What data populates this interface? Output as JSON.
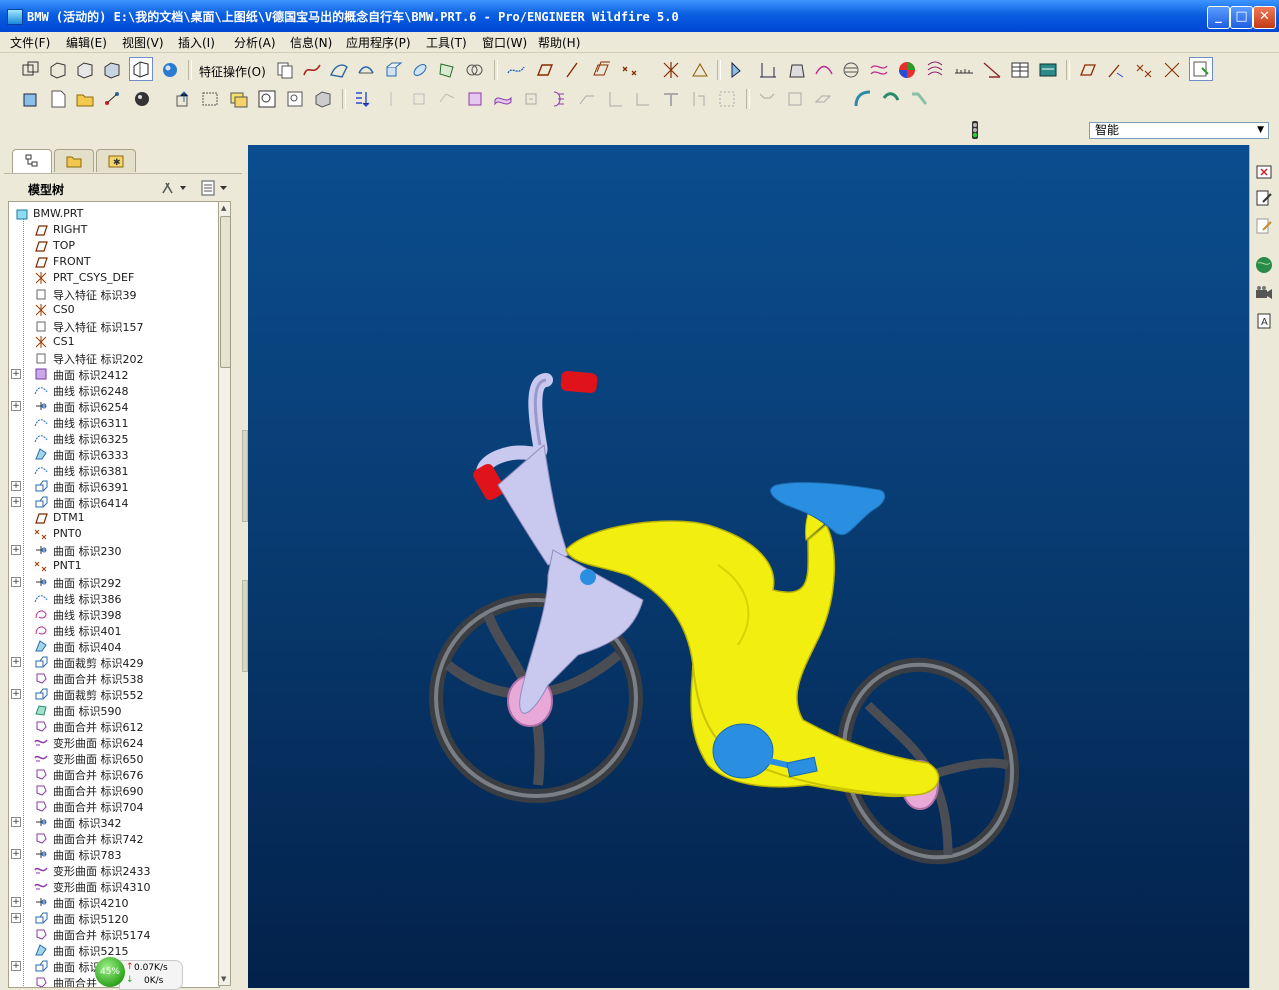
{
  "window": {
    "title": "BMW (活动的) E:\\我的文档\\桌面\\上图纸\\V德国宝马出的概念自行车\\BMW.PRT.6 - Pro/ENGINEER Wildfire 5.0",
    "minimize": "_",
    "maximize": "□",
    "close": "✕"
  },
  "menu": [
    "文件(F)",
    "编辑(E)",
    "视图(V)",
    "插入(I)",
    "分析(A)",
    "信息(N)",
    "应用程序(P)",
    "工具(T)",
    "窗口(W)",
    "帮助(H)"
  ],
  "toolbar": {
    "feature_ops_label": "特征操作(O)"
  },
  "filter": {
    "selected": "智能"
  },
  "model_tree": {
    "title": "模型树",
    "root": "BMW.PRT",
    "items": [
      {
        "label": "RIGHT",
        "icon": "datum-plane-icon",
        "expand": false
      },
      {
        "label": "TOP",
        "icon": "datum-plane-icon",
        "expand": false
      },
      {
        "label": "FRONT",
        "icon": "datum-plane-icon",
        "expand": false
      },
      {
        "label": "PRT_CSYS_DEF",
        "icon": "csys-icon",
        "expand": false
      },
      {
        "label": "导入特征 标识39",
        "icon": "import-feature-icon",
        "expand": false
      },
      {
        "label": "CS0",
        "icon": "csys-icon",
        "expand": false
      },
      {
        "label": "导入特征 标识157",
        "icon": "import-feature-icon",
        "expand": false
      },
      {
        "label": "CS1",
        "icon": "csys-icon",
        "expand": false
      },
      {
        "label": "导入特征 标识202",
        "icon": "import-feature-icon",
        "expand": false
      },
      {
        "label": "曲面 标识2412",
        "icon": "surface-icon",
        "expand": true
      },
      {
        "label": "曲线 标识6248",
        "icon": "curve-icon",
        "expand": false
      },
      {
        "label": "曲面 标识6254",
        "icon": "extrude-surface-icon",
        "expand": true
      },
      {
        "label": "曲线 标识6311",
        "icon": "curve-icon",
        "expand": false
      },
      {
        "label": "曲线 标识6325",
        "icon": "curve-icon",
        "expand": false
      },
      {
        "label": "曲面 标识6333",
        "icon": "boundary-surface-icon",
        "expand": false
      },
      {
        "label": "曲线 标识6381",
        "icon": "curve-icon",
        "expand": false
      },
      {
        "label": "曲面 标识6391",
        "icon": "sweep-surface-icon",
        "expand": true
      },
      {
        "label": "曲面 标识6414",
        "icon": "sweep-surface-icon",
        "expand": true
      },
      {
        "label": "DTM1",
        "icon": "datum-plane-icon",
        "expand": false
      },
      {
        "label": "PNT0",
        "icon": "datum-point-icon",
        "expand": false
      },
      {
        "label": "曲面 标识230",
        "icon": "extrude-surface-icon",
        "expand": true
      },
      {
        "label": "PNT1",
        "icon": "datum-point-icon",
        "expand": false
      },
      {
        "label": "曲面 标识292",
        "icon": "extrude-surface-icon",
        "expand": true
      },
      {
        "label": "曲线 标识386",
        "icon": "curve-icon",
        "expand": false
      },
      {
        "label": "曲线 标识398",
        "icon": "sketch-curve-icon",
        "expand": false
      },
      {
        "label": "曲线 标识401",
        "icon": "sketch-curve-icon",
        "expand": false
      },
      {
        "label": "曲面 标识404",
        "icon": "boundary-surface-icon",
        "expand": false
      },
      {
        "label": "曲面裁剪 标识429",
        "icon": "sweep-surface-icon",
        "expand": true
      },
      {
        "label": "曲面合并 标识538",
        "icon": "merge-icon",
        "expand": false
      },
      {
        "label": "曲面裁剪 标识552",
        "icon": "sweep-surface-icon",
        "expand": true
      },
      {
        "label": "曲面 标识590",
        "icon": "fill-surface-icon",
        "expand": false
      },
      {
        "label": "曲面合并 标识612",
        "icon": "merge-icon",
        "expand": false
      },
      {
        "label": "变形曲面 标识624",
        "icon": "warp-icon",
        "expand": false
      },
      {
        "label": "变形曲面 标识650",
        "icon": "warp-icon",
        "expand": false
      },
      {
        "label": "曲面合并 标识676",
        "icon": "merge-icon",
        "expand": false
      },
      {
        "label": "曲面合并 标识690",
        "icon": "merge-icon",
        "expand": false
      },
      {
        "label": "曲面合并 标识704",
        "icon": "merge-icon",
        "expand": false
      },
      {
        "label": "曲面 标识342",
        "icon": "extrude-surface-icon",
        "expand": true
      },
      {
        "label": "曲面合并 标识742",
        "icon": "merge-icon",
        "expand": false
      },
      {
        "label": "曲面 标识783",
        "icon": "extrude-surface-icon",
        "expand": true
      },
      {
        "label": "变形曲面 标识2433",
        "icon": "warp-icon",
        "expand": false
      },
      {
        "label": "变形曲面 标识4310",
        "icon": "warp-icon",
        "expand": false
      },
      {
        "label": "曲面 标识4210",
        "icon": "extrude-surface-icon",
        "expand": true
      },
      {
        "label": "曲面 标识5120",
        "icon": "sweep-surface-icon",
        "expand": true
      },
      {
        "label": "曲面合并 标识5174",
        "icon": "merge-icon",
        "expand": false
      },
      {
        "label": "曲面 标识5215",
        "icon": "boundary-surface-icon",
        "expand": false
      },
      {
        "label": "曲面 标识",
        "icon": "sweep-surface-icon",
        "expand": true
      },
      {
        "label": "曲面合并",
        "icon": "merge-icon",
        "expand": false
      }
    ]
  },
  "net_meter": {
    "percent": "45%",
    "upload": "0.07K/s",
    "download": "0K/s"
  },
  "colors": {
    "viewport_top": "#0b4d8f",
    "viewport_bottom": "#03214a",
    "frame_yellow": "#f2ee10",
    "fork_lavender": "#c9c8ee",
    "seat_blue": "#2a8fe0",
    "grip_red": "#e0121a",
    "hub_pink": "#e8a8d8",
    "tire_gray": "#555a60"
  }
}
